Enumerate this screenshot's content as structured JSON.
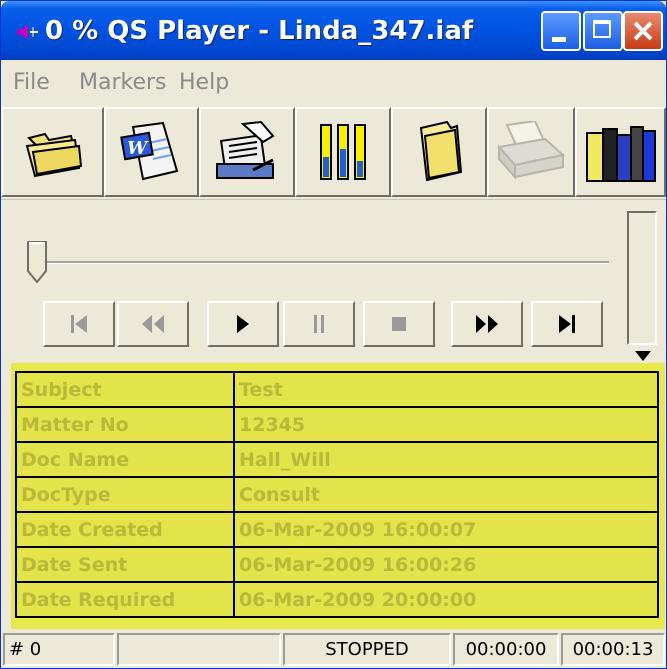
{
  "window": {
    "title": "0 % QS Player - Linda_347.iaf"
  },
  "menu": {
    "items": [
      "File",
      "Markers",
      "Help"
    ]
  },
  "toolbar": {
    "buttons": [
      "folder-open-icon",
      "word-document-icon",
      "dictation-typing-icon",
      "level-meters-icon",
      "folder-icon",
      "print-icon",
      "books-icon"
    ]
  },
  "transport": {
    "buttons": [
      "skip-to-start",
      "rewind",
      "play",
      "pause",
      "stop",
      "fast-forward",
      "skip-to-end"
    ]
  },
  "info": {
    "rows": [
      {
        "label": "Subject",
        "value": "Test"
      },
      {
        "label": "Matter No",
        "value": "12345"
      },
      {
        "label": "Doc Name",
        "value": "Hall_Will"
      },
      {
        "label": "DocType",
        "value": "Consult"
      },
      {
        "label": "Date Created",
        "value": "06-Mar-2009 16:00:07"
      },
      {
        "label": "Date Sent",
        "value": "06-Mar-2009 16:00:26"
      },
      {
        "label": "Date Required",
        "value": "06-Mar-2009 20:00:00"
      }
    ]
  },
  "status": {
    "marker": "# 0",
    "blank": "",
    "state": "STOPPED",
    "position": "00:00:00",
    "length": "00:00:13"
  },
  "colors": {
    "title_bar": "#0054e3",
    "info_panel": "#e3e34a",
    "info_text": "#b9b93a"
  }
}
